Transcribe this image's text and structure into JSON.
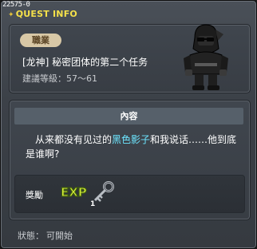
{
  "window": {
    "quest_id": "22575-0",
    "title": "QUEST INFO"
  },
  "header": {
    "job_badge": "職業",
    "quest_name": "[龙神]  秘密团体的第二个任务",
    "level_recommendation": "建議等級：57～61"
  },
  "content": {
    "section_label": "內容",
    "description_before": "从来都没有见过的",
    "description_highlight": "黑色影子",
    "description_after": "和我说话……他到底是谁啊?",
    "colors": {
      "highlight": "#6de6ff",
      "title": "#f4e04a"
    }
  },
  "reward": {
    "label": "獎勵",
    "exp_icon": "exp-icon",
    "item_icon": "key-icon",
    "item_quantity": "1"
  },
  "status": {
    "label": "狀態：",
    "value": "可開始"
  }
}
